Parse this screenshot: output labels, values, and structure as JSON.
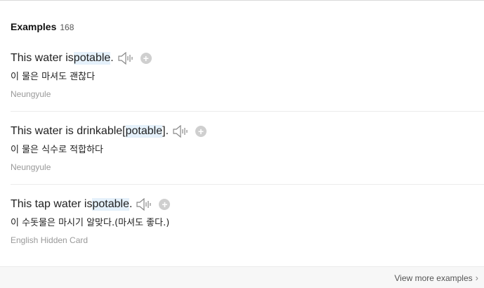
{
  "header": {
    "title": "Examples",
    "count": "168"
  },
  "examples": [
    {
      "pre": "This water is ",
      "hl": "potable",
      "post": ".",
      "meaning": "이 물은 마셔도 괜찮다",
      "source": "Neungyule"
    },
    {
      "pre": "This water is drinkable[",
      "hl": "potable",
      "post": "].",
      "meaning": "이 물은 식수로 적합하다",
      "source": "Neungyule"
    },
    {
      "pre": "This tap water is ",
      "hl": "potable",
      "post": ".",
      "meaning": "이 수돗물은 마시기 알맞다.(마셔도 좋다.)",
      "source": "English Hidden Card"
    }
  ],
  "footer": {
    "more_label": "View more examples"
  },
  "icons": {
    "speaker": "speaker-icon",
    "add": "plus-circle-icon",
    "chevron": "chevron-right-icon"
  },
  "colors": {
    "highlight": "#e5f1fb",
    "source_text": "#999999"
  }
}
